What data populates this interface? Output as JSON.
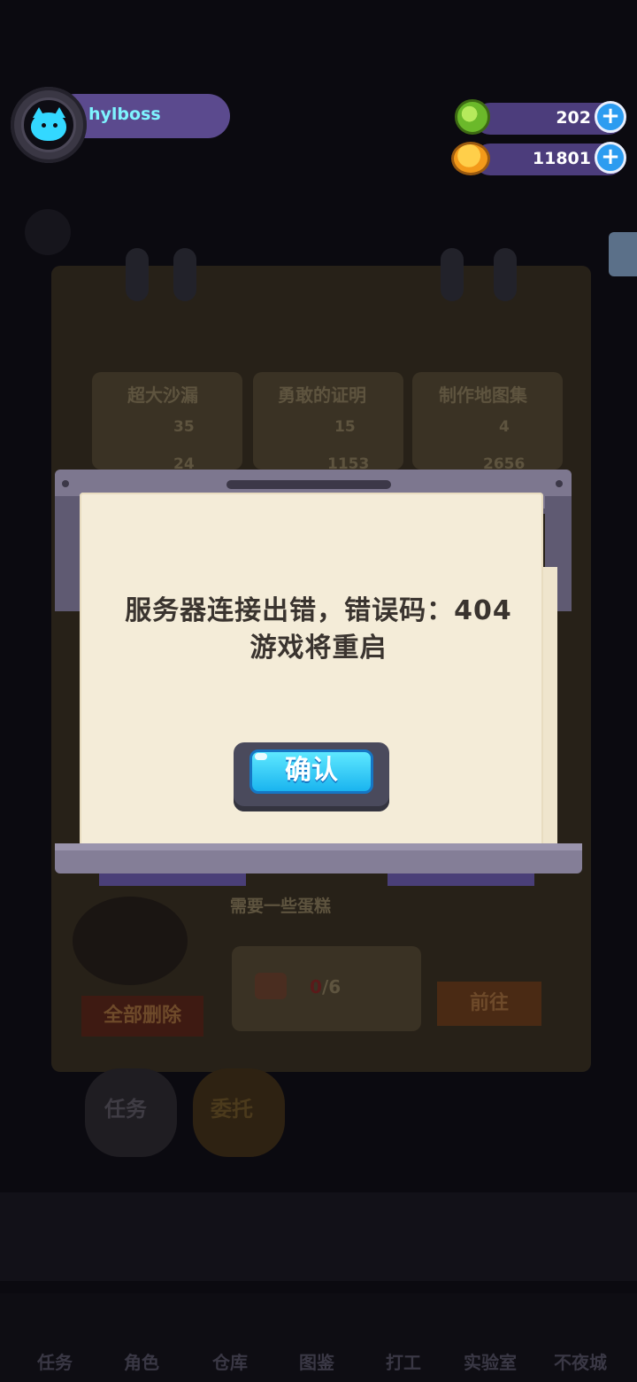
{
  "hud": {
    "username": "hylboss",
    "gems": "202",
    "coins": "11801",
    "avatar_icon": "cat-avatar-icon",
    "plus_symbol": "+"
  },
  "background": {
    "items": [
      {
        "title": "超大沙漏",
        "cost1": "35",
        "cost2": "24"
      },
      {
        "title": "勇敢的证明",
        "cost1": "15",
        "cost2": "1153"
      },
      {
        "title": "制作地图集",
        "cost1": "4",
        "cost2": "2656"
      }
    ],
    "task_desc": "需要一些蛋糕",
    "task_progress_have": "0",
    "task_progress_total": "/6",
    "goto_label": "前往",
    "delete_all_label": "全部删除",
    "tab_task": "任务",
    "tab_commission": "委托",
    "nav": [
      "任务",
      "角色",
      "仓库",
      "图鉴",
      "打工",
      "实验室",
      "不夜城"
    ]
  },
  "dialog": {
    "line1": "服务器连接出错，错误码：404",
    "line2": "游戏将重启",
    "confirm_label": "确认"
  },
  "colors": {
    "accent_blue": "#33d8ff",
    "pill_purple": "#4c3d7c",
    "paper": "#f4ecd8"
  }
}
